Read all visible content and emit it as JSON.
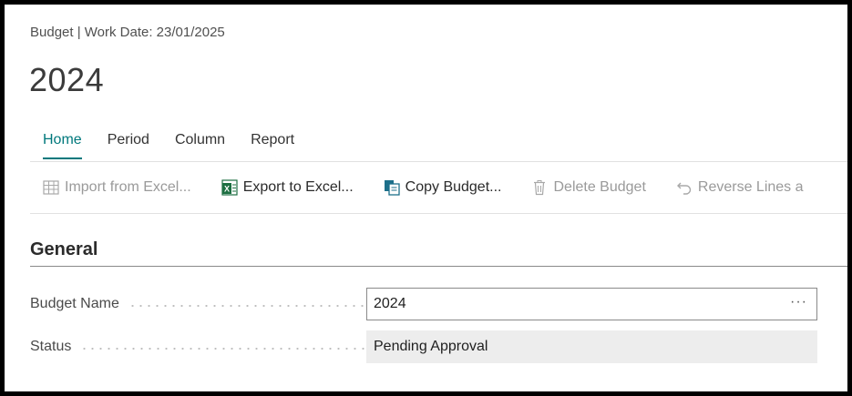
{
  "header": {
    "breadcrumb": "Budget | Work Date: 23/01/2025",
    "title": "2024"
  },
  "tabs": [
    {
      "label": "Home",
      "active": true
    },
    {
      "label": "Period",
      "active": false
    },
    {
      "label": "Column",
      "active": false
    },
    {
      "label": "Report",
      "active": false
    }
  ],
  "actions": [
    {
      "label": "Import from Excel...",
      "icon": "import-excel-icon",
      "enabled": false
    },
    {
      "label": "Export to Excel...",
      "icon": "export-excel-icon",
      "enabled": true
    },
    {
      "label": "Copy Budget...",
      "icon": "copy-icon",
      "enabled": true
    },
    {
      "label": "Delete Budget",
      "icon": "trash-icon",
      "enabled": false
    },
    {
      "label": "Reverse Lines a",
      "icon": "undo-icon",
      "enabled": false
    }
  ],
  "section": {
    "title": "General"
  },
  "fields": {
    "budget_name": {
      "label": "Budget Name",
      "value": "2024",
      "lookup": "···"
    },
    "status": {
      "label": "Status",
      "value": "Pending Approval"
    }
  },
  "colors": {
    "accent": "#00787c",
    "excel_green": "#1d6f42",
    "disabled": "#9a9a9a",
    "readonly_bg": "#ededed"
  }
}
